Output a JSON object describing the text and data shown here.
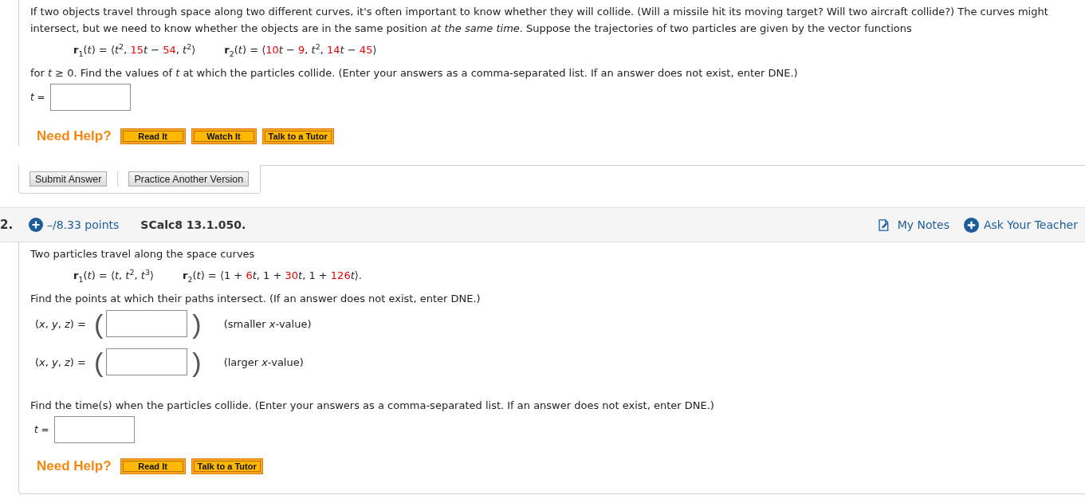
{
  "question_1": {
    "intro": "If two objects travel through space along two different curves, it's often important to know whether they will collide. (Will a missile hit its moving target? Will two aircraft collide?) The curves might intersect, but we need to know whether the objects are in the same position *at the same time*. Suppose the trajectories of two particles are given by the vector functions",
    "formulas": [
      {
        "segments": [
          {
            "text": "**r**$_{1}$(*t*) = ⟨*t*$^{2}$, ",
            "highlight": false
          },
          {
            "text": "15",
            "highlight": true
          },
          {
            "text": "*t* − ",
            "highlight": false
          },
          {
            "text": "54",
            "highlight": true
          },
          {
            "text": ", *t*$^{2}$⟩",
            "highlight": false
          }
        ]
      },
      {
        "segments": [
          {
            "text": "**r**$_{2}$(*t*) = ⟨",
            "highlight": false
          },
          {
            "text": "10",
            "highlight": true
          },
          {
            "text": "*t* − ",
            "highlight": false
          },
          {
            "text": "9",
            "highlight": true
          },
          {
            "text": ", *t*$^{2}$, ",
            "highlight": false
          },
          {
            "text": "14",
            "highlight": true
          },
          {
            "text": "*t* − ",
            "highlight": false
          },
          {
            "text": "45",
            "highlight": true
          },
          {
            "text": "⟩",
            "highlight": false
          }
        ]
      }
    ],
    "prompt": "for *t* ≥ 0. Find the values of *t* at which the particles collide. (Enter your answers as a comma-separated list. If an answer does not exist, enter DNE.)",
    "answer": {
      "label": "*t* ="
    },
    "help": {
      "label": "Need Help?",
      "buttons": [
        "Read It",
        "Watch It",
        "Talk to a Tutor"
      ]
    },
    "actions": [
      "Submit Answer",
      "Practice Another Version"
    ]
  },
  "question_2": {
    "number": "2.",
    "points": "–/8.33 points",
    "code": "SCalc8 13.1.050.",
    "links": [
      {
        "kind": "notes",
        "label": "My Notes"
      },
      {
        "kind": "ask",
        "label": "Ask Your Teacher"
      }
    ],
    "intro": "Two particles travel along the space curves",
    "formulas": [
      {
        "segments": [
          {
            "text": "**r**$_{1}$(*t*) = ⟨*t*, *t*$^{2}$, *t*$^{3}$⟩",
            "highlight": false
          }
        ]
      },
      {
        "segments": [
          {
            "text": "**r**$_{2}$(*t*) = ⟨1 + ",
            "highlight": false
          },
          {
            "text": "6",
            "highlight": true
          },
          {
            "text": "*t*, 1 + ",
            "highlight": false
          },
          {
            "text": "30",
            "highlight": true
          },
          {
            "text": "*t*, 1 + ",
            "highlight": false
          },
          {
            "text": "126",
            "highlight": true
          },
          {
            "text": "*t*⟩.",
            "highlight": false
          }
        ]
      }
    ],
    "prompt": "Find the points at which their paths intersect. (If an answer does not exist, enter DNE.)",
    "point_answers": [
      {
        "label": "(*x*, *y*, *z*) =",
        "open": "(",
        "close": ")",
        "hint": "(smaller *x*-value)"
      },
      {
        "label": "(*x*, *y*, *z*) =",
        "open": "(",
        "close": ")",
        "hint": "(larger *x*-value)"
      }
    ],
    "prompt_2": "Find the time(s) when the particles collide. (Enter your answers as a comma-separated list. If an answer does not exist, enter DNE.)",
    "answer": {
      "label": "*t* ="
    },
    "help": {
      "label": "Need Help?",
      "buttons": [
        "Read It",
        "Talk to a Tutor"
      ]
    }
  }
}
